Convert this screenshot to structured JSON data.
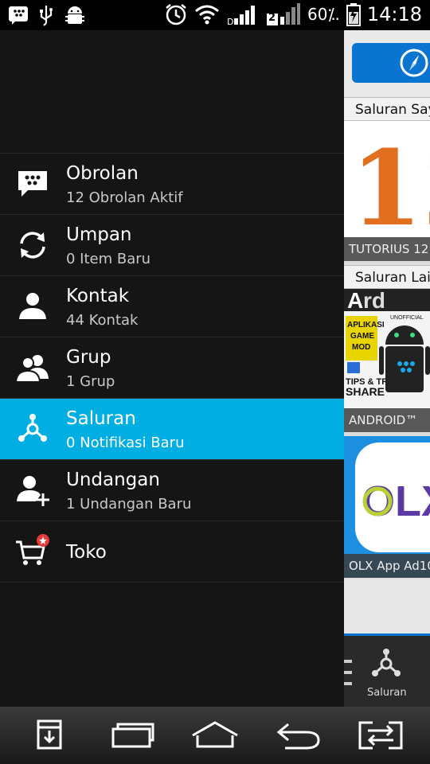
{
  "status": {
    "battery": "60⁒.",
    "time": "14:18",
    "sim2": "2"
  },
  "menu": {
    "items": [
      {
        "title": "Obrolan",
        "subtitle": "12 Obrolan Aktif",
        "icon": "bbm-chat-icon"
      },
      {
        "title": "Umpan",
        "subtitle": "0 Item Baru",
        "icon": "refresh-icon"
      },
      {
        "title": "Kontak",
        "subtitle": "44 Kontak",
        "icon": "contact-icon"
      },
      {
        "title": "Grup",
        "subtitle": "1 Grup",
        "icon": "group-icon"
      },
      {
        "title": "Saluran",
        "subtitle": "0 Notifikasi Baru",
        "icon": "channels-icon"
      },
      {
        "title": "Undangan",
        "subtitle": "1 Undangan Baru",
        "icon": "invite-icon"
      },
      {
        "title": "Toko",
        "subtitle": "",
        "icon": "shop-cart-icon"
      }
    ],
    "active_index": 4
  },
  "content": {
    "section1": "Saluran Saya",
    "section2": "Saluran Lainnya",
    "thumb1_caption": "TUTORIUS 12",
    "thumb2_caption": "ANDROID™",
    "thumb3_caption": "OLX App Ad10",
    "thumb2_lines": [
      "APLIKASI",
      "GAME",
      "MOD",
      "TIPS & TRIK",
      "SHARE",
      "UNOFFICIAL"
    ],
    "tab_label": "Saluran"
  },
  "colors": {
    "accent": "#00aee1",
    "content_blue": "#0a74d1",
    "drawer_bg": "#151515"
  }
}
